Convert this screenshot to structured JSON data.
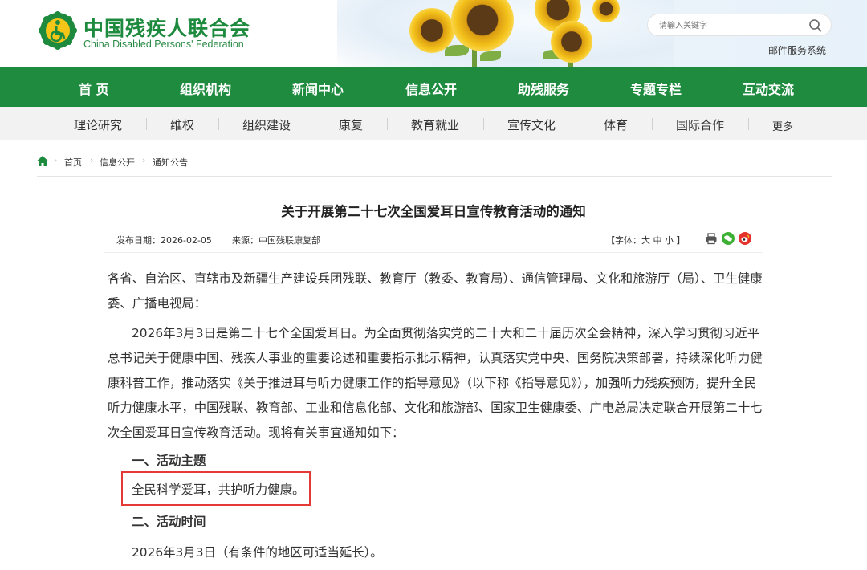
{
  "header": {
    "brand_cn": "中国残疾人联合会",
    "brand_en": "China Disabled Persons' Federation",
    "search_placeholder": "请输入关键字",
    "mail_link": "邮件服务系统",
    "brand_color": "#1d8a3e"
  },
  "main_nav": {
    "color": "#1f8b3f",
    "items": [
      "首 页",
      "组织机构",
      "新闻中心",
      "信息公开",
      "助残服务",
      "专题专栏",
      "互动交流"
    ]
  },
  "sub_nav": {
    "items": [
      "理论研究",
      "维权",
      "组织建设",
      "康复",
      "教育就业",
      "宣传文化",
      "体育",
      "国际合作",
      "更多"
    ]
  },
  "breadcrumb": {
    "items": [
      "首页",
      "信息公开",
      "通知公告"
    ]
  },
  "article": {
    "title": "关于开展第二十七次全国爱耳日宣传教育活动的通知",
    "date_label": "发布日期：2026-02-05",
    "source_label": "来源：中国残联康复部",
    "font_size_prefix": "【字体：",
    "font_size_options": [
      "大",
      "中",
      "小"
    ],
    "font_size_suffix": "】",
    "share_icons": [
      "print-icon",
      "wechat-icon",
      "weibo-icon"
    ],
    "salutation": "各省、自治区、直辖市及新疆生产建设兵团残联、教育厅（教委、教育局）、通信管理局、文化和旅游厅（局）、卫生健康委、广播电视局：",
    "intro": "2026年3月3日是第二十七个全国爱耳日。为全面贯彻落实党的二十大和二十届历次全会精神，深入学习贯彻习近平总书记关于健康中国、残疾人事业的重要论述和重要指示批示精神，认真落实党中央、国务院决策部署，持续深化听力健康科普工作，推动落实《关于推进耳与听力健康工作的指导意见》（以下称《指导意见》），加强听力残疾预防，提升全民听力健康水平，中国残联、教育部、工业和信息化部、文化和旅游部、国家卫生健康委、广电总局决定联合开展第二十七次全国爱耳日宣传教育活动。现将有关事宜通知如下：",
    "section1_heading": "一、活动主题",
    "section1_text": "全民科学爱耳，共护听力健康。",
    "section2_heading": "二、活动时间",
    "section2_text": "2026年3月3日（有条件的地区可适当延长）。",
    "highlight_color": "#e53935"
  }
}
